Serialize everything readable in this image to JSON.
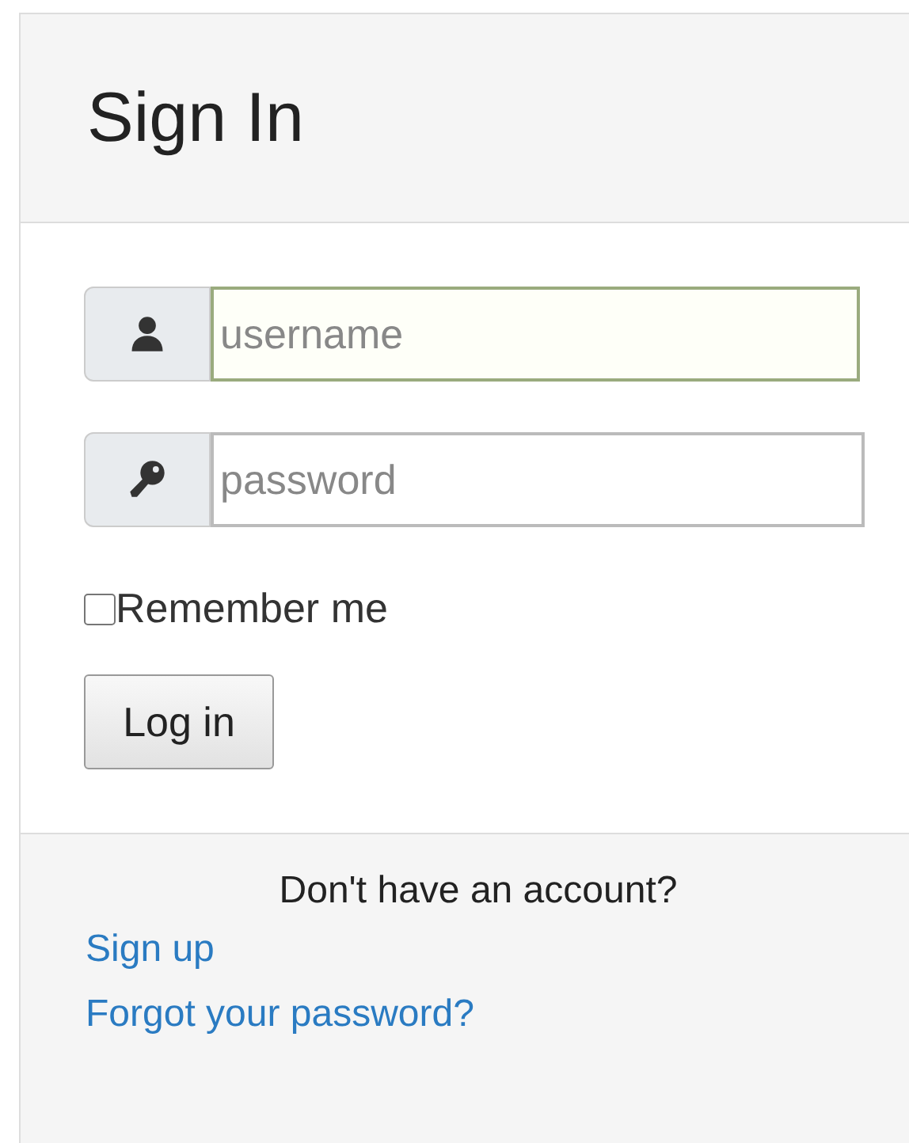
{
  "title": "Sign In",
  "fields": [
    {
      "kind": "user",
      "placeholder": "username",
      "focused": true
    },
    {
      "kind": "key",
      "placeholder": "password",
      "focused": false
    }
  ],
  "remember": {
    "label": "Remember me",
    "checked": false
  },
  "submit": "Log in",
  "footer": {
    "prompt": "Don't have an account?",
    "links": [
      "Sign up",
      "Forgot your password?"
    ]
  }
}
